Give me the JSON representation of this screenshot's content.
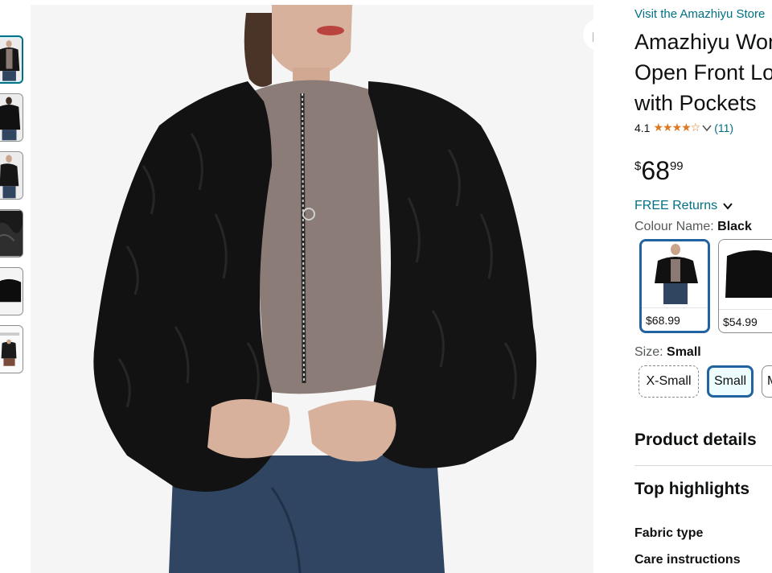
{
  "product": {
    "store_link": "Visit the Amazhiyu Store",
    "title_lines": [
      "Amazhiyu Women's Faux Fur",
      "Open Front Long Sleeve Jacket",
      "with Pockets"
    ],
    "rating_value": "4.1",
    "stars": "★★★★☆",
    "review_count": "(11)",
    "price_symbol": "$",
    "price_whole": "68",
    "price_fraction": "99",
    "returns": "FREE Returns",
    "colour_label": "Colour Name:",
    "colour_value": "Black",
    "size_label": "Size:",
    "size_value": "Small"
  },
  "colour_options": [
    {
      "name": "Black",
      "price": "$68.99",
      "selected": true
    },
    {
      "name": "Black cropped",
      "price": "$54.99",
      "selected": false
    }
  ],
  "size_options": [
    {
      "label": "X-Small",
      "state": "unavailable"
    },
    {
      "label": "Small",
      "state": "selected"
    },
    {
      "label": "M",
      "state": "available"
    }
  ],
  "sections": {
    "product_details": "Product details",
    "top_highlights": "Top highlights",
    "fabric_type": "Fabric type",
    "care_instructions": "Care instructions"
  },
  "thumbnails": [
    "front-view",
    "back-view",
    "side-view",
    "fur-detail",
    "flat-lay",
    "size-chart"
  ],
  "icons": {
    "share": "share-icon",
    "chevron": "chevron-down-icon",
    "star": "star-icon"
  },
  "colors": {
    "link": "#007185",
    "star": "#de7921",
    "selected_border": "#2162a1",
    "text": "#0f1111"
  }
}
